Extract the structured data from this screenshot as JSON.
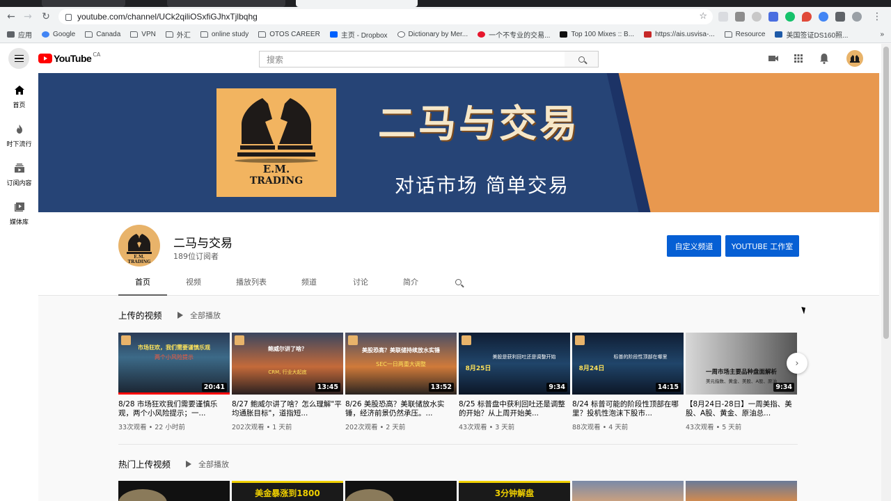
{
  "browser": {
    "url": "youtube.com/channel/UCk2qiliOSxfiGJhxTjlbqhg",
    "bookmarks": [
      "应用",
      "Google",
      "Canada",
      "VPN",
      "外汇",
      "online study",
      "OTOS CAREER",
      "主页 - Dropbox",
      "Dictionary by Mer...",
      "一个不专业的交易...",
      "Top 100 Mixes :: B...",
      "https://ais.usvisa-...",
      "Resource",
      "美国签证DS160照..."
    ],
    "bookmarks_more": "»"
  },
  "header": {
    "logo_text": "YouTube",
    "region": "CA",
    "search_placeholder": "搜索"
  },
  "guide": {
    "items": [
      "首页",
      "时下流行",
      "订阅内容",
      "媒体库"
    ]
  },
  "banner": {
    "title": "二马与交易",
    "subtitle": "对话市场 简单交易",
    "logo_line1": "E.M.",
    "logo_line2": "TRADING"
  },
  "channel": {
    "name": "二马与交易",
    "subscribers": "189位订阅者",
    "customize_label": "自定义频道",
    "studio_label": "YOUTUBE 工作室",
    "avatar_line1": "E.M.",
    "avatar_line2": "TRADING",
    "tabs": [
      "首页",
      "视频",
      "播放列表",
      "频道",
      "讨论",
      "简介"
    ]
  },
  "sections": {
    "uploads_title": "上传的视频",
    "popular_title": "热门上传视频",
    "play_all": "全部播放"
  },
  "videos": [
    {
      "title": "8/28 市场狂欢我们需要谨慎乐观，两个小风险提示；一...",
      "meta": "33次观看 • 22 小时前",
      "duration": "20:41",
      "t1": "市场狂欢，我们需要谨慎乐观",
      "t2": "两个小风险提示"
    },
    {
      "title": "8/27 鲍威尔讲了啥？怎么理解\"平均通胀目标\"，道指短...",
      "meta": "202次观看 • 1 天前",
      "duration": "13:45",
      "t1": "鲍威尔讲了啥？",
      "t2": "CRM, 行业大起底"
    },
    {
      "title": "8/26 美股恐高？美联储放水实锤，经济前景仍然承压。...",
      "meta": "202次观看 • 2 天前",
      "duration": "13:52",
      "t1": "美股恐高？美联储持续放水实锤",
      "t2": "SEC一日两重大调整"
    },
    {
      "title": "8/25 标普盘中获利回吐还是调整的开始？从上周开始美...",
      "meta": "43次观看 • 3 天前",
      "duration": "9:34",
      "t1": "8月25日",
      "t2": "美股是获利回吐还是调整开始"
    },
    {
      "title": "8/24 标普可能的阶段性顶部在哪里？投机性泡沫下股市...",
      "meta": "88次观看 • 4 天前",
      "duration": "14:15",
      "t1": "8月24日",
      "t2": "标普的阶段性顶部在哪里"
    },
    {
      "title": "【8月24日-28日】一周美指、美股、A股、黄金、原油总...",
      "meta": "43次观看 • 5 天前",
      "duration": "9:34",
      "t1": "一周市场主要品种盘面解析",
      "t2": "美元指数、黄金、美股、A股、原油"
    }
  ],
  "popular_thumbs": [
    "美金暴涨到1800",
    "3分钟解盘"
  ],
  "colors": {
    "accent": "#065fd4",
    "brand": "#ff0000",
    "banner_blue": "#264476",
    "banner_orange": "#e8984f"
  }
}
